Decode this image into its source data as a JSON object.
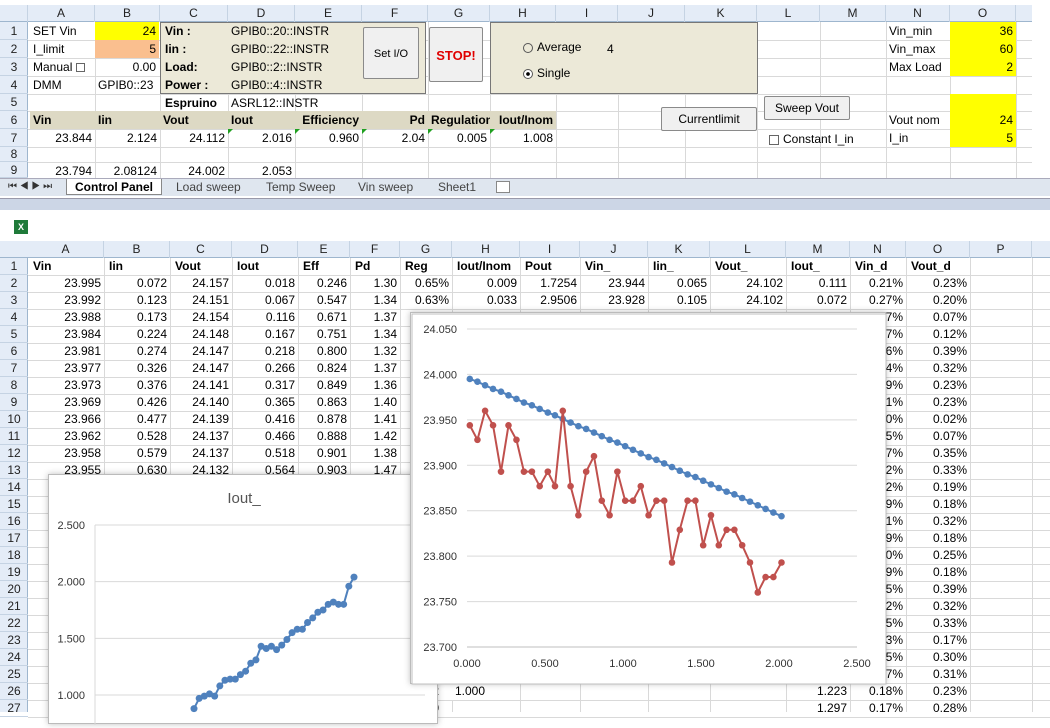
{
  "top": {
    "columns": [
      "A",
      "B",
      "C",
      "D",
      "E",
      "F",
      "G",
      "H",
      "I",
      "J",
      "K",
      "L",
      "M",
      "N",
      "O"
    ],
    "rows": [
      "1",
      "2",
      "3",
      "4",
      "5",
      "6",
      "7",
      "8",
      "9"
    ],
    "set_vin_label": "SET Vin",
    "set_vin": "24",
    "i_limit_label": "I_limit",
    "i_limit": "5",
    "manual_label": "Manual",
    "manual_val": "0.00",
    "dmm_label": "DMM",
    "dmm_val": "GPIB0::23",
    "vin_lbl": "Vin :",
    "vin_addr": "GPIB0::20::INSTR",
    "iin_lbl": "Iin :",
    "iin_addr": "GPIB0::22::INSTR",
    "load_lbl": "Load:",
    "load_addr": "GPIB0::2::INSTR",
    "power_lbl": "Power :",
    "power_addr": "GPIB0::4::INSTR",
    "espruino_lbl": "Espruino",
    "espruino_addr": "ASRL12::INSTR",
    "set_io": "Set I/O",
    "stop": "STOP!",
    "average": "Average",
    "single": "Single",
    "avg_count": "4",
    "currentlimit": "Currentlimit",
    "sweep_vout": "Sweep Vout",
    "const_iin": "Constant I_in",
    "vin_min_lbl": "Vin_min",
    "vin_min": "36",
    "vin_max_lbl": "Vin_max",
    "vin_max": "60",
    "maxload_lbl": "Max Load",
    "maxload": "2",
    "vout_nom_lbl": "Vout nom",
    "vout_nom": "24",
    "i_in_lbl": "I_in",
    "i_in": "5",
    "hdr": [
      "Vin",
      "Iin",
      "Vout",
      "Iout",
      "Efficiency",
      "Pd",
      "Regulation",
      "Iout/Inom"
    ],
    "r7": [
      "23.844",
      "2.124",
      "24.112",
      "2.016",
      "0.960",
      "2.04",
      "0.005",
      "1.008"
    ],
    "r9": [
      "23.794",
      "2.08124",
      "24.002",
      "2.053"
    ],
    "sheet_tabs": [
      "Control Panel",
      "Load sweep",
      "Temp Sweep",
      "Vin sweep",
      "Sheet1"
    ]
  },
  "bottom": {
    "columns": [
      "A",
      "B",
      "C",
      "D",
      "E",
      "F",
      "G",
      "H",
      "I",
      "J",
      "K",
      "L",
      "M",
      "N",
      "O",
      "P"
    ],
    "headers": [
      "Vin",
      "Iin",
      "Vout",
      "Iout",
      "Eff",
      "Pd",
      "Reg",
      "Iout/Inom",
      "Pout",
      "Vin_",
      "Iin_",
      "Vout_",
      "Iout_",
      "Vin_d",
      "Vout_d"
    ],
    "rows": [
      [
        "23.995",
        "0.072",
        "24.157",
        "0.018",
        "0.246",
        "1.30",
        "0.65%",
        "0.009",
        "1.7254",
        "23.944",
        "0.065",
        "24.102",
        "0.111",
        "0.21%",
        "0.23%"
      ],
      [
        "23.992",
        "0.123",
        "24.151",
        "0.067",
        "0.547",
        "1.34",
        "0.63%",
        "0.033",
        "2.9506",
        "23.928",
        "0.105",
        "24.102",
        "0.072",
        "0.27%",
        "0.20%"
      ],
      [
        "23.988",
        "0.173",
        "24.154",
        "0.116",
        "0.671",
        "1.37",
        "",
        "",
        "",
        "",
        "",
        "",
        "",
        "7%",
        "0.07%"
      ],
      [
        "23.984",
        "0.224",
        "24.148",
        "0.167",
        "0.751",
        "1.34",
        "",
        "",
        "",
        "",
        "",
        "",
        "",
        "7%",
        "0.12%"
      ],
      [
        "23.981",
        "0.274",
        "24.147",
        "0.218",
        "0.800",
        "1.32",
        "",
        "",
        "",
        "",
        "",
        "",
        "",
        "6%",
        "0.39%"
      ],
      [
        "23.977",
        "0.326",
        "24.147",
        "0.266",
        "0.824",
        "1.37",
        "",
        "",
        "",
        "",
        "",
        "",
        "",
        "4%",
        "0.32%"
      ],
      [
        "23.973",
        "0.376",
        "24.141",
        "0.317",
        "0.849",
        "1.36",
        "",
        "",
        "",
        "",
        "",
        "",
        "",
        "9%",
        "0.23%"
      ],
      [
        "23.969",
        "0.426",
        "24.140",
        "0.365",
        "0.863",
        "1.40",
        "",
        "",
        "",
        "",
        "",
        "",
        "",
        "1%",
        "0.23%"
      ],
      [
        "23.966",
        "0.477",
        "24.139",
        "0.416",
        "0.878",
        "1.41",
        "",
        "",
        "",
        "",
        "",
        "",
        "",
        "0%",
        "0.02%"
      ],
      [
        "23.962",
        "0.528",
        "24.137",
        "0.466",
        "0.888",
        "1.42",
        "",
        "",
        "",
        "",
        "",
        "",
        "",
        "5%",
        "0.07%"
      ],
      [
        "23.958",
        "0.579",
        "24.137",
        "0.518",
        "0.901",
        "1.38",
        "",
        "",
        "",
        "",
        "",
        "",
        "",
        "7%",
        "0.35%"
      ],
      [
        "23.955",
        "0.630",
        "24.132",
        "0.564",
        "0.903",
        "1.47",
        "",
        "",
        "",
        "",
        "",
        "",
        "",
        "2%",
        "0.33%"
      ]
    ],
    "rownums": [
      "1",
      "2",
      "3",
      "4",
      "5",
      "6",
      "7",
      "8",
      "9",
      "10",
      "11",
      "12",
      "13",
      "14",
      "15",
      "16",
      "17",
      "18",
      "19",
      "20",
      "21",
      "22",
      "23",
      "24",
      "25",
      "26",
      "27"
    ],
    "right_o": [
      "0.19%",
      "0.18%",
      "0.32%",
      "0.18%",
      "0.25%",
      "0.18%",
      "0.39%",
      "0.32%",
      "0.33%",
      "0.17%",
      "0.30%",
      "0.31%",
      "0.23%",
      "0.28%"
    ],
    "right_n": [
      "2%",
      "9%",
      "1%",
      "9%",
      "0%",
      "9%",
      "5%",
      "2%",
      "5%",
      "3%",
      "5%",
      "7%",
      "0.18%",
      "0.17%"
    ],
    "row26_m": "1.223",
    "row27_m": "1.297",
    "partial_h": "2",
    "partial_h27": "0",
    "small_axis_val": "1.000"
  },
  "chart_data": [
    {
      "type": "line",
      "title": "Iout_",
      "ylim": [
        1.0,
        2.5
      ],
      "yticks": [
        "2.500",
        "2.000",
        "1.500",
        "1.000"
      ],
      "series": [
        {
          "values": [
            0.88,
            0.97,
            0.99,
            1.01,
            0.99,
            1.08,
            1.13,
            1.14,
            1.14,
            1.18,
            1.21,
            1.28,
            1.31,
            1.43,
            1.41,
            1.43,
            1.4,
            1.44,
            1.49,
            1.55,
            1.58,
            1.58,
            1.64,
            1.68,
            1.73,
            1.75,
            1.8,
            1.82,
            1.8,
            1.8,
            1.96,
            2.04
          ]
        }
      ]
    },
    {
      "type": "line",
      "ylim": [
        23.7,
        24.05
      ],
      "xlim": [
        0,
        2.5
      ],
      "yticks": [
        "24.050",
        "24.000",
        "23.950",
        "23.900",
        "23.850",
        "23.800",
        "23.750",
        "23.700"
      ],
      "xticks": [
        "0.000",
        "0.500",
        "1.000",
        "1.500",
        "2.000",
        "2.500"
      ],
      "series": [
        {
          "color": "#4f81bd",
          "x": [
            0.018,
            0.067,
            0.116,
            0.167,
            0.218,
            0.266,
            0.317,
            0.365,
            0.416,
            0.466,
            0.518,
            0.564,
            0.614,
            0.664,
            0.714,
            0.764,
            0.814,
            0.864,
            0.914,
            0.964,
            1.014,
            1.064,
            1.114,
            1.164,
            1.214,
            1.264,
            1.314,
            1.364,
            1.414,
            1.464,
            1.514,
            1.564,
            1.614,
            1.664,
            1.714,
            1.764,
            1.814,
            1.864,
            1.914,
            1.964,
            2.016
          ],
          "y": [
            23.995,
            23.992,
            23.988,
            23.984,
            23.981,
            23.977,
            23.973,
            23.969,
            23.966,
            23.962,
            23.958,
            23.955,
            23.951,
            23.947,
            23.943,
            23.94,
            23.936,
            23.932,
            23.928,
            23.925,
            23.921,
            23.917,
            23.913,
            23.909,
            23.906,
            23.902,
            23.898,
            23.894,
            23.89,
            23.887,
            23.883,
            23.879,
            23.875,
            23.871,
            23.868,
            23.864,
            23.86,
            23.856,
            23.852,
            23.848,
            23.844
          ]
        },
        {
          "color": "#c0504d",
          "x": [
            0.018,
            0.067,
            0.116,
            0.167,
            0.218,
            0.266,
            0.317,
            0.365,
            0.416,
            0.466,
            0.518,
            0.564,
            0.614,
            0.664,
            0.714,
            0.764,
            0.814,
            0.864,
            0.914,
            0.964,
            1.014,
            1.064,
            1.114,
            1.164,
            1.214,
            1.264,
            1.314,
            1.364,
            1.414,
            1.464,
            1.514,
            1.564,
            1.614,
            1.664,
            1.714,
            1.764,
            1.814,
            1.864,
            1.914,
            1.964,
            2.016
          ],
          "y": [
            23.944,
            23.928,
            23.96,
            23.944,
            23.893,
            23.944,
            23.928,
            23.893,
            23.893,
            23.877,
            23.893,
            23.877,
            23.96,
            23.877,
            23.845,
            23.893,
            23.91,
            23.861,
            23.845,
            23.893,
            23.861,
            23.861,
            23.877,
            23.845,
            23.861,
            23.861,
            23.793,
            23.829,
            23.861,
            23.861,
            23.812,
            23.845,
            23.812,
            23.829,
            23.829,
            23.812,
            23.793,
            23.76,
            23.777,
            23.777,
            23.793
          ]
        }
      ]
    }
  ]
}
